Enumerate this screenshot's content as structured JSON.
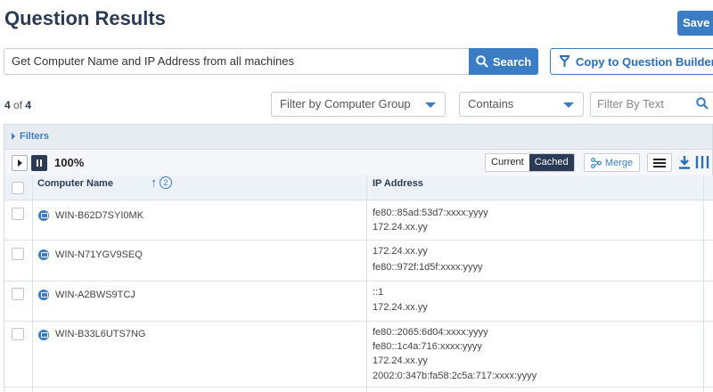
{
  "header": {
    "title": "Question Results",
    "save_label": "Save"
  },
  "query": {
    "text": "Get Computer Name and IP Address from all machines",
    "search_label": "Search",
    "copy_label": "Copy to Question Builder"
  },
  "results": {
    "shown": "4",
    "of_label": "of",
    "total": "4"
  },
  "filters": {
    "group_placeholder": "Filter by Computer Group",
    "match_mode": "Contains",
    "text_placeholder": "Filter By Text",
    "bar_label": "Filters"
  },
  "toolbar": {
    "progress": "100%",
    "current_label": "Current",
    "cached_label": "Cached",
    "merge_label": "Merge",
    "active_mode": "Cached"
  },
  "table": {
    "columns": [
      {
        "label": "Computer Name",
        "sort": "ascending",
        "sort_order": "2"
      },
      {
        "label": "IP Address"
      }
    ],
    "rows": [
      {
        "name": "WIN-B62D7SYI0MK",
        "ips": [
          "fe80::85ad:53d7:xxxx:yyyy",
          "172.24.xx.yy"
        ]
      },
      {
        "name": "WIN-N71YGV9SEQ",
        "ips": [
          "172.24.xx.yy",
          "fe80::972f:1d5f:xxxx:yyyy"
        ]
      },
      {
        "name": "WIN-A2BWS9TCJ",
        "ips": [
          "::1",
          "172.24.xx.yy"
        ]
      },
      {
        "name": "WIN-B33L6UTS7NG",
        "ips": [
          "fe80::2065:6d04:xxxx:yyyy",
          "fe80::1c4a:716:xxxx:yyyy",
          "172.24.xx.yy",
          "2002:0:347b:fa58:2c5a:717:xxxx:yyyy"
        ]
      }
    ]
  },
  "colors": {
    "accent": "#3b7dc4",
    "navy": "#2b3a55",
    "header_bg": "#edf2f8"
  },
  "icons": [
    "search-icon",
    "funnel-icon",
    "chevron-down-icon",
    "play-icon",
    "pause-icon",
    "merge-icon",
    "menu-icon",
    "download-icon",
    "columns-icon",
    "computer-icon"
  ]
}
